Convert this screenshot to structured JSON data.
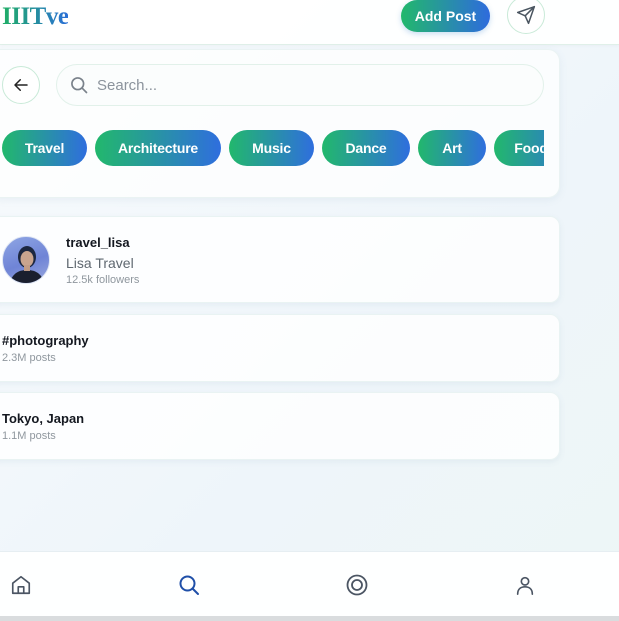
{
  "header": {
    "logo": "IIITve",
    "add_post_label": "Add Post",
    "send_icon": "paper-plane-icon"
  },
  "search": {
    "back_icon": "arrow-left-icon",
    "search_icon": "magnifier-icon",
    "placeholder": "Search...",
    "value": ""
  },
  "categories": [
    "Travel",
    "Architecture",
    "Music",
    "Dance",
    "Art",
    "Food"
  ],
  "results": {
    "user": {
      "handle": "travel_lisa",
      "name": "Lisa Travel",
      "followers": "12.5k followers"
    },
    "hashtag": {
      "title": "#photography",
      "count": "2.3M posts"
    },
    "location": {
      "title": "Tokyo, Japan",
      "count": "1.1M posts"
    }
  },
  "bottom_nav": {
    "items": [
      "home-icon",
      "search-icon",
      "reels-icon",
      "profile-icon"
    ],
    "active": "search-icon"
  },
  "colors": {
    "accent_green": "#22b86c",
    "accent_blue": "#2e6bdd",
    "active_nav": "#1f4fa8",
    "inactive_nav": "#4b5563"
  }
}
